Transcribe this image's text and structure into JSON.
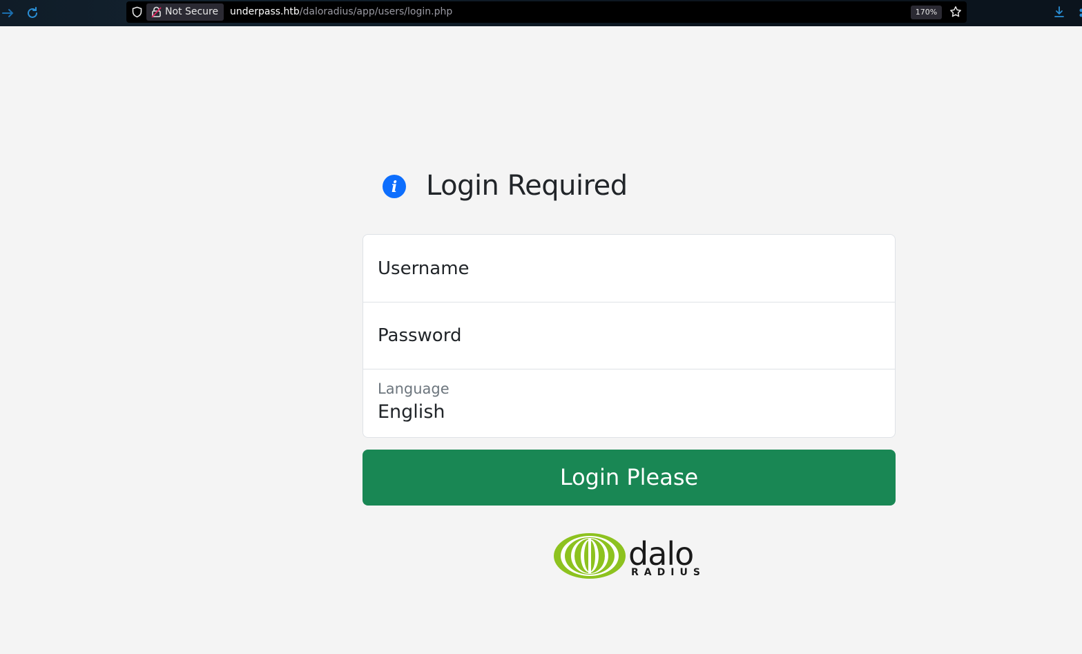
{
  "browser": {
    "security_label": "Not Secure",
    "url_host": "underpass.htb",
    "url_path": "/daloradius/app/users/login.php",
    "zoom": "170%",
    "icons": [
      "forward-icon",
      "reload-icon",
      "shield-icon",
      "lock-icon",
      "star-icon",
      "download-icon"
    ]
  },
  "page": {
    "title": "Login Required",
    "title_icon": "info-icon",
    "accent_color": "#0d6efd"
  },
  "form": {
    "username_placeholder": "Username",
    "password_placeholder": "Password",
    "language_label": "Language",
    "language_value": "English",
    "submit_label": "Login Please",
    "submit_color": "#198754"
  },
  "footer": {
    "logo_text_main": "dalo",
    "logo_text_sub": "RADIUS",
    "logo_color": "#8dc21f"
  }
}
